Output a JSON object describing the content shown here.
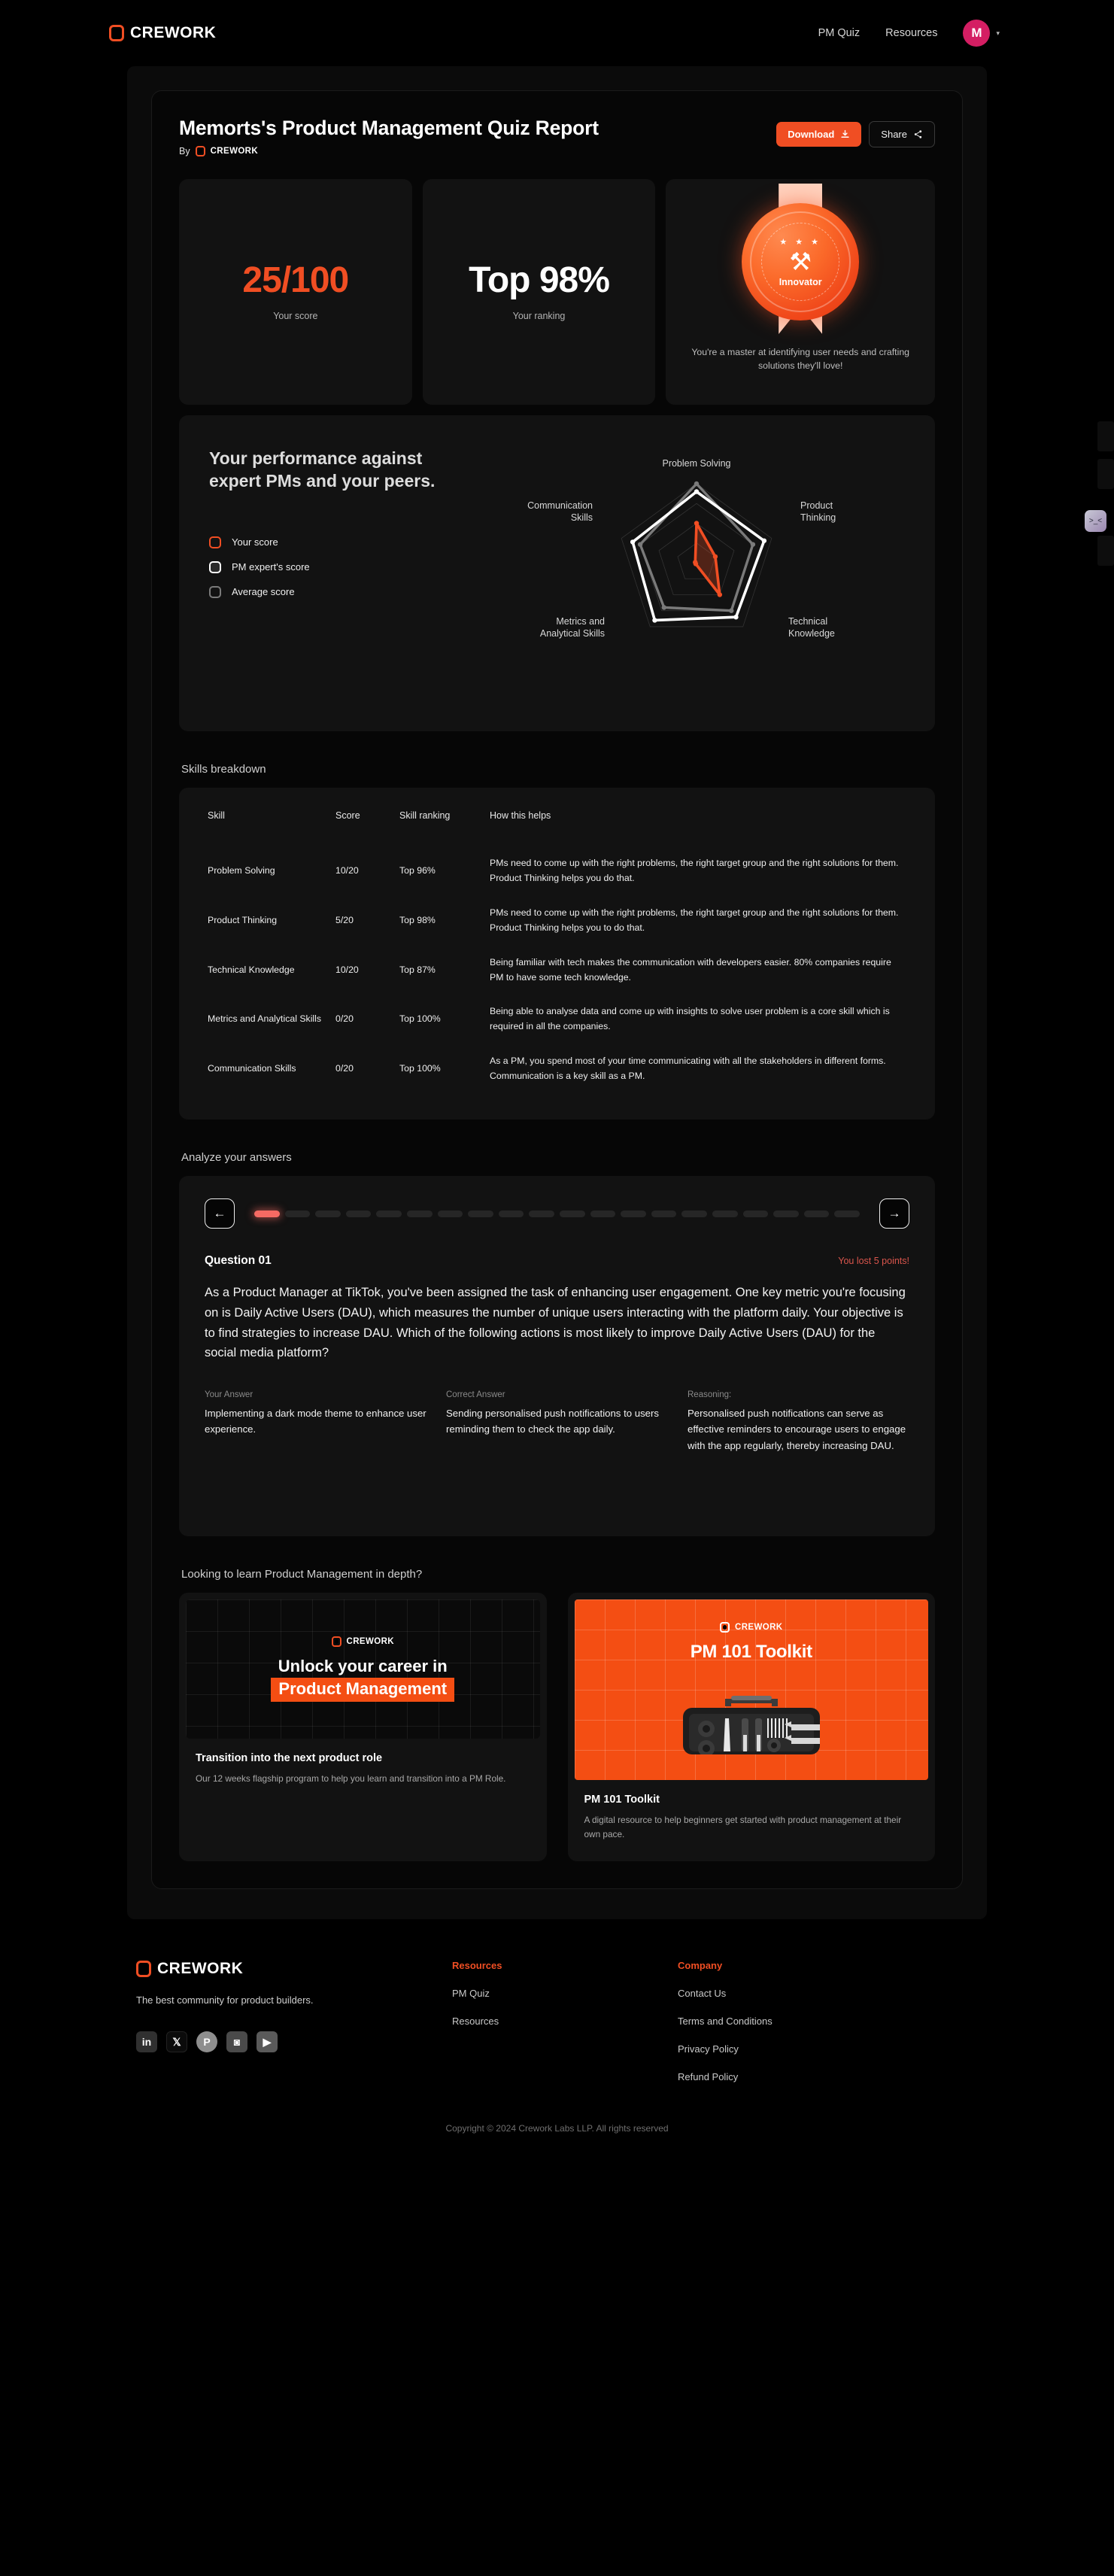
{
  "nav": {
    "brand": "CREWORK",
    "links": [
      "PM Quiz",
      "Resources"
    ],
    "avatar_initial": "M",
    "caret": "▾"
  },
  "report": {
    "title": "Memorts's Product Management Quiz Report",
    "by_label": "By",
    "by_brand": "CREWORK",
    "download_label": "Download",
    "download_icon": "download-icon",
    "share_label": "Share",
    "share_icon": "share-icon"
  },
  "stats": {
    "score_value": "25/100",
    "score_label": "Your score",
    "rank_value": "Top 98%",
    "rank_label": "Your ranking",
    "badge": {
      "name": "Innovator",
      "stars": "★ ★ ★",
      "tools_icon": "hammer-wrench-icon",
      "description": "You're a master at identifying user needs and crafting solutions they'll love!"
    }
  },
  "performance": {
    "heading": "Your performance against expert PMs and your peers.",
    "legend": [
      {
        "label": "Your score",
        "color": "#F04E23"
      },
      {
        "label": "PM expert's score",
        "color": "#FFFFFF"
      },
      {
        "label": "Average score",
        "color": "#7A7A7A"
      }
    ]
  },
  "chart_data": {
    "type": "radar",
    "title": "Your performance against expert PMs and your peers.",
    "axes": [
      "Problem Solving",
      "Product Thinking",
      "Technical Knowledge",
      "Metrics and Analytical Skills",
      "Communication Skills"
    ],
    "max": 20,
    "rlim": [
      0,
      20
    ],
    "grid": true,
    "legend_position": "left",
    "series": [
      {
        "name": "Your score",
        "color": "#F04E23",
        "values": [
          10,
          5,
          10,
          0,
          0
        ]
      },
      {
        "name": "PM expert's score",
        "color": "#FFFFFF",
        "values": [
          18,
          18,
          17,
          18,
          17
        ]
      },
      {
        "name": "Average score",
        "color": "#7A7A7A",
        "values": [
          20,
          15,
          15,
          14,
          15
        ]
      }
    ]
  },
  "skills": {
    "section_label": "Skills breakdown",
    "columns": [
      "Skill",
      "Score",
      "Skill ranking",
      "How this helps"
    ],
    "rows": [
      {
        "skill": "Problem Solving",
        "score": "10/20",
        "ranking": "Top 96%",
        "help": "PMs need to come up with the right problems, the right target group and the right solutions for them. Product Thinking helps you do that."
      },
      {
        "skill": "Product Thinking",
        "score": "5/20",
        "ranking": "Top 98%",
        "help": "PMs need to come up with the right problems, the right target group and the right solutions for them. Product Thinking helps you to do that."
      },
      {
        "skill": "Technical Knowledge",
        "score": "10/20",
        "ranking": "Top 87%",
        "help": "Being familiar with tech makes the communication with developers easier. 80% companies require PM to have some tech knowledge."
      },
      {
        "skill": "Metrics and Analytical Skills",
        "score": "0/20",
        "ranking": "Top 100%",
        "help": "Being able to analyse data and come up with insights to solve user problem is a core skill which is required in all the companies."
      },
      {
        "skill": "Communication Skills",
        "score": "0/20",
        "ranking": "Top 100%",
        "help": "As a PM, you spend most of your time communicating with all the stakeholders in different forms. Communication is a key skill as a PM."
      }
    ]
  },
  "analyze": {
    "section_label": "Analyze your answers",
    "prev_icon": "arrow-left-icon",
    "next_icon": "arrow-right-icon",
    "total_segments": 20,
    "active_segment": 1,
    "question_number": "Question 01",
    "points_note": "You lost 5 points!",
    "question_text": "As a Product Manager at TikTok, you've been assigned the task of enhancing user engagement. One key metric you're focusing on is Daily Active Users (DAU), which measures the number of unique users interacting with the platform daily. Your objective is to find strategies to increase DAU. Which of the following actions is most likely to improve Daily Active Users (DAU) for the social media platform?",
    "answers": [
      {
        "label": "Your Answer",
        "text": "Implementing a dark mode theme to enhance user experience."
      },
      {
        "label": "Correct Answer",
        "text": "Sending personalised push notifications to users reminding them to check the app daily."
      },
      {
        "label": "Reasoning:",
        "text": "Personalised push notifications can serve as effective reminders to encourage users to engage with the app regularly, thereby increasing DAU."
      }
    ]
  },
  "promo": {
    "section_label": "Looking to learn Product Management in depth?",
    "cards": [
      {
        "hero_brand": "CREWORK",
        "hero_line1": "Unlock your career in",
        "hero_highlight": "Product Management",
        "title": "Transition into the next product role",
        "subtitle": "Our 12 weeks flagship program to help you learn and transition into a PM Role."
      },
      {
        "hero_brand": "CREWORK",
        "hero_line1": "PM 101 Toolkit",
        "hero_icon": "toolbox-icon",
        "title": "PM 101 Toolkit",
        "subtitle": "A digital resource to help beginners get started with product management at their own pace."
      }
    ]
  },
  "footer": {
    "brand": "CREWORK",
    "tagline": "The best community for product builders.",
    "socials": [
      {
        "name": "linkedin-icon",
        "glyph": "in"
      },
      {
        "name": "x-twitter-icon",
        "glyph": "𝕏"
      },
      {
        "name": "product-hunt-icon",
        "glyph": "P"
      },
      {
        "name": "instagram-icon",
        "glyph": "◙"
      },
      {
        "name": "youtube-icon",
        "glyph": "▶"
      }
    ],
    "columns": [
      {
        "heading": "Resources",
        "links": [
          "PM Quiz",
          "Resources"
        ]
      },
      {
        "heading": "Company",
        "links": [
          "Contact Us",
          "Terms and Conditions",
          "Privacy Policy",
          "Refund Policy"
        ]
      }
    ],
    "copyright": "Copyright © 2024 Crework Labs LLP. All rights reserved"
  },
  "widget": {
    "icon": ">_<",
    "name": "feedback-widget"
  }
}
